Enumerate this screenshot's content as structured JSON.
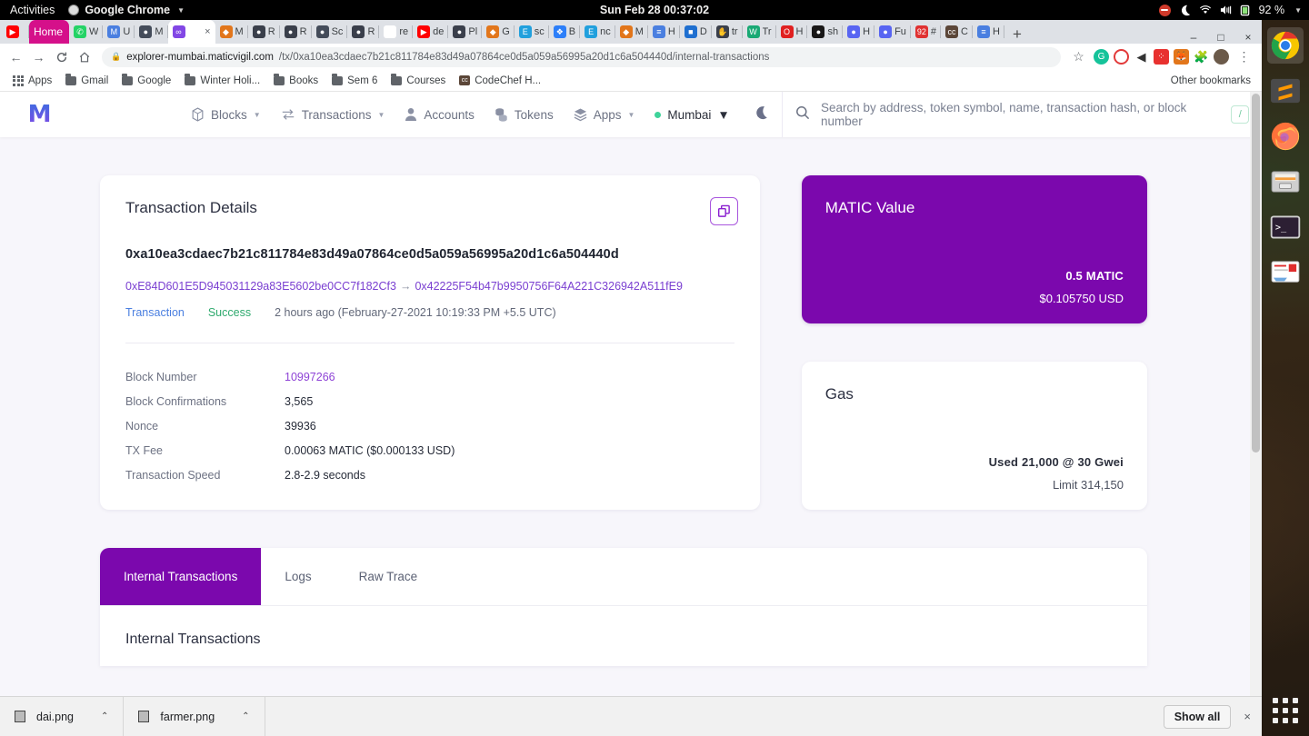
{
  "os": {
    "activities": "Activities",
    "app_menu": "Google Chrome",
    "clock": "Sun Feb 28  00:37:02",
    "battery": "92 %",
    "tray_icons": [
      "do-not-disturb-icon",
      "night-light-icon",
      "wifi-icon",
      "volume-icon",
      "battery-icon"
    ]
  },
  "browser": {
    "tabs": [
      {
        "label": "",
        "fav": "youtube-icon",
        "color": "#ff0000",
        "glyph": "▶"
      },
      {
        "label": "Home",
        "fav": "pinned",
        "color": "#d5108a",
        "glyph": "",
        "pinned": true
      },
      {
        "label": "W",
        "fav": "whatsapp-icon",
        "color": "#25d366",
        "glyph": "✆"
      },
      {
        "label": "U",
        "fav": "mail-icon",
        "color": "#4a7fe0",
        "glyph": "M"
      },
      {
        "label": "M",
        "fav": "globe-icon",
        "color": "#444c5a",
        "glyph": "●"
      },
      {
        "label": "",
        "fav": "matic-icon",
        "color": "#8247e5",
        "glyph": "∞",
        "active": true
      },
      {
        "label": "M",
        "fav": "metamask-icon",
        "color": "#e2761b",
        "glyph": "◆"
      },
      {
        "label": "R",
        "fav": "remix-icon",
        "color": "#3a3f4b",
        "glyph": "●"
      },
      {
        "label": "R",
        "fav": "remix-icon",
        "color": "#3a3f4b",
        "glyph": "●"
      },
      {
        "label": "Sc",
        "fav": "globe-icon",
        "color": "#444c5a",
        "glyph": "●"
      },
      {
        "label": "R",
        "fav": "remix-icon",
        "color": "#3a3f4b",
        "glyph": "●"
      },
      {
        "label": "re",
        "fav": "google-icon",
        "color": "#ffffff",
        "glyph": "G"
      },
      {
        "label": "de",
        "fav": "youtube-icon",
        "color": "#ff0000",
        "glyph": "▶"
      },
      {
        "label": "Pl",
        "fav": "remix-icon",
        "color": "#3a3f4b",
        "glyph": "●"
      },
      {
        "label": "G",
        "fav": "metamask-icon",
        "color": "#e2761b",
        "glyph": "◆"
      },
      {
        "label": "sc",
        "fav": "etherscan-icon",
        "color": "#21a0dd",
        "glyph": "E"
      },
      {
        "label": "B",
        "fav": "blockscout-icon",
        "color": "#2d7ff9",
        "glyph": "❖"
      },
      {
        "label": "nc",
        "fav": "etherscan-icon",
        "color": "#21a0dd",
        "glyph": "E"
      },
      {
        "label": "M",
        "fav": "metamask-icon",
        "color": "#e2761b",
        "glyph": "◆"
      },
      {
        "label": "H",
        "fav": "doc-icon",
        "color": "#4a7fe0",
        "glyph": "≡"
      },
      {
        "label": "D",
        "fav": "media-icon",
        "color": "#1f6fd0",
        "glyph": "■"
      },
      {
        "label": "tr",
        "fav": "hand-icon",
        "color": "#3a3f4b",
        "glyph": "✋"
      },
      {
        "label": "Tr",
        "fav": "w-icon",
        "color": "#19a974",
        "glyph": "W"
      },
      {
        "label": "H",
        "fav": "opera-icon",
        "color": "#e02020",
        "glyph": "O"
      },
      {
        "label": "sh",
        "fav": "github-icon",
        "color": "#181717",
        "glyph": "●"
      },
      {
        "label": "H",
        "fav": "discord-icon",
        "color": "#5865f2",
        "glyph": "●"
      },
      {
        "label": "Fu",
        "fav": "discord-icon",
        "color": "#5865f2",
        "glyph": "●"
      },
      {
        "label": "#",
        "fav": "counter-icon",
        "color": "#e03131",
        "glyph": "92"
      },
      {
        "label": "C",
        "fav": "codechef-icon",
        "color": "#5b4638",
        "glyph": "cc"
      },
      {
        "label": "H",
        "fav": "doc-icon",
        "color": "#4a7fe0",
        "glyph": "≡"
      }
    ],
    "new_tab_label": "+",
    "window_controls": {
      "minimize": "–",
      "maximize": "□",
      "close": "×"
    },
    "omnibox": {
      "host": "explorer-mumbai.maticvigil.com",
      "path": "/tx/0xa10ea3cdaec7b21c811784e83d49a07864ce0d5a059a56995a20d1c6a504440d/internal-transactions"
    },
    "nav": {
      "back": "←",
      "forward": "→",
      "reload": "C",
      "home": "⌂",
      "star": "☆",
      "menu": "⋮"
    },
    "extensions": [
      "grammarly-icon",
      "adblock-icon",
      "pocket-icon",
      "colorzilla-icon",
      "metamask-icon",
      "puzzle-icon",
      "profile-avatar"
    ],
    "bookmarks": [
      {
        "label": "Apps",
        "icon": "apps-grid-icon"
      },
      {
        "label": "Gmail",
        "icon": "folder-icon"
      },
      {
        "label": "Google",
        "icon": "folder-icon"
      },
      {
        "label": "Winter Holi...",
        "icon": "folder-icon"
      },
      {
        "label": "Books",
        "icon": "folder-icon"
      },
      {
        "label": "Sem 6",
        "icon": "folder-icon"
      },
      {
        "label": "Courses",
        "icon": "folder-icon"
      },
      {
        "label": "CodeChef H...",
        "icon": "codechef-icon"
      }
    ],
    "other_bookmarks": "Other bookmarks"
  },
  "site": {
    "logo_text": "M",
    "nav": [
      {
        "label": "Blocks",
        "icon": "cube-icon",
        "dropdown": true
      },
      {
        "label": "Transactions",
        "icon": "transfer-icon",
        "dropdown": true
      },
      {
        "label": "Accounts",
        "icon": "person-icon",
        "dropdown": false
      },
      {
        "label": "Tokens",
        "icon": "coins-icon",
        "dropdown": false
      },
      {
        "label": "Apps",
        "icon": "layers-icon",
        "dropdown": true
      }
    ],
    "network": "Mumbai",
    "theme_toggle": "moon-icon",
    "search": {
      "placeholder": "Search by address, token symbol, name, transaction hash, or block number",
      "shortcut": "/"
    }
  },
  "tx": {
    "card_title": "Transaction Details",
    "copy_button": "copy-icon",
    "hash": "0xa10ea3cdaec7b21c811784e83d49a07864ce0d5a059a56995a20d1c6a504440d",
    "from": "0xE84D601E5D945031129a83E5602be0CC7f182Cf3",
    "arrow": "→",
    "to": "0x42225F54b47b9950756F64A221C326942A511fE9",
    "type_label": "Transaction",
    "status": "Success",
    "timestamp": "2 hours ago (February-27-2021 10:19:33 PM +5.5 UTC)",
    "details": [
      {
        "key": "Block Number",
        "value": "10997266",
        "link": true
      },
      {
        "key": "Block Confirmations",
        "value": "3,565",
        "link": false
      },
      {
        "key": "Nonce",
        "value": "39936",
        "link": false
      },
      {
        "key": "TX Fee",
        "value": "0.00063 MATIC ($0.000133 USD)",
        "link": false
      },
      {
        "key": "Transaction Speed",
        "value": "2.8-2.9 seconds",
        "link": false
      }
    ]
  },
  "matic_card": {
    "title": "MATIC Value",
    "amount": "0.5 MATIC",
    "usd": "$0.105750 USD",
    "bg_color": "#7b08ad"
  },
  "gas_card": {
    "title": "Gas",
    "used": "Used 21,000 @ 30 Gwei",
    "limit": "Limit 314,150"
  },
  "tabs_panel": {
    "tabs": [
      {
        "label": "Internal Transactions",
        "active": true
      },
      {
        "label": "Logs",
        "active": false
      },
      {
        "label": "Raw Trace",
        "active": false
      }
    ],
    "body_heading": "Internal Transactions",
    "active_color": "#7b08ad"
  },
  "downloads": {
    "items": [
      {
        "name": "dai.png",
        "chevron": "⌃"
      },
      {
        "name": "farmer.png",
        "chevron": "⌃"
      }
    ],
    "show_all": "Show all",
    "close": "×"
  },
  "dock": {
    "apps": [
      "chrome-icon",
      "sublime-text-icon",
      "firefox-icon",
      "files-icon",
      "terminal-icon",
      "text-editor-icon"
    ],
    "show_apps": "show-applications-icon"
  }
}
